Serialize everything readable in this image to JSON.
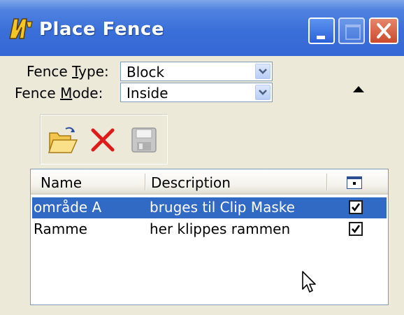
{
  "window": {
    "title": "Place Fence",
    "app_icon": "microstation-icon",
    "controls": {
      "minimize": "minimize-icon",
      "maximize": "maximize-icon",
      "close": "close-icon"
    }
  },
  "fence_type": {
    "label_pre": "Fence ",
    "label_accel": "T",
    "label_post": "ype:",
    "value": "Block"
  },
  "fence_mode": {
    "label_pre": "Fence ",
    "label_accel": "M",
    "label_post": "ode:",
    "value": "Inside"
  },
  "toolbar": {
    "items": [
      "open-folder-icon",
      "delete-icon",
      "save-icon"
    ]
  },
  "list": {
    "columns": {
      "name": "Name",
      "description": "Description",
      "display_icon": "display-toggle-icon"
    },
    "rows": [
      {
        "name": "område A",
        "description": "bruges til Clip Maske",
        "checked": true,
        "selected": true
      },
      {
        "name": "Ramme",
        "description": "her klippes rammen",
        "checked": true,
        "selected": false
      }
    ]
  },
  "colors": {
    "titlebar": "#3a6fd8",
    "selection": "#316ac5",
    "dialog_bg": "#ece9d8"
  }
}
